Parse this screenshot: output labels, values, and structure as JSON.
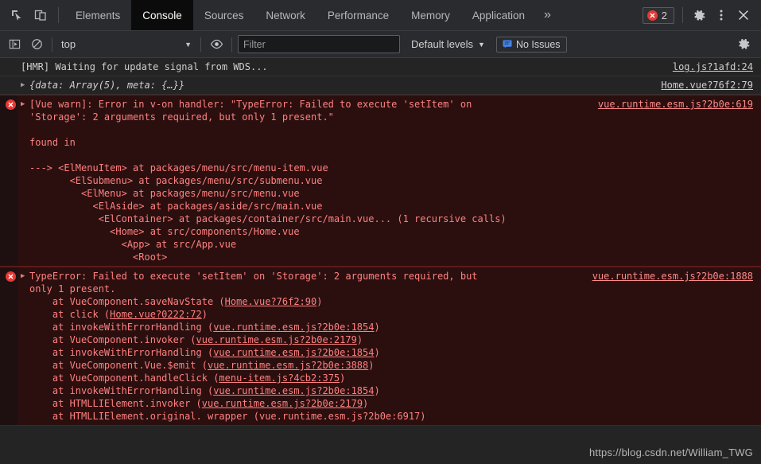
{
  "tabbar": {
    "icons": [
      {
        "name": "inspect-element-icon"
      },
      {
        "name": "device-toolbar-icon"
      }
    ],
    "tabs": [
      {
        "label": "Elements",
        "active": false
      },
      {
        "label": "Console",
        "active": true
      },
      {
        "label": "Sources",
        "active": false
      },
      {
        "label": "Network",
        "active": false
      },
      {
        "label": "Performance",
        "active": false
      },
      {
        "label": "Memory",
        "active": false
      },
      {
        "label": "Application",
        "active": false
      }
    ],
    "more_label": "»",
    "error_count": "2",
    "settings_icon": "gear-icon",
    "menu_icon": "kebab-menu-icon",
    "close_icon": "close-icon"
  },
  "filterbar": {
    "sidebar_toggle_icon": "console-sidebar-icon",
    "clear_icon": "clear-console-icon",
    "context": "top",
    "eye_icon": "live-expression-eye-icon",
    "filter_placeholder": "Filter",
    "filter_value": "",
    "levels_label": "Default levels",
    "issues_label": "No Issues",
    "issues_icon": "issues-message-icon",
    "settings_icon": "gear-icon"
  },
  "console": {
    "messages": [
      {
        "type": "log",
        "text": "[HMR] Waiting for update signal from WDS...",
        "source": "log.js?1afd:24",
        "expandable": false
      },
      {
        "type": "log",
        "text": "{data: Array(5), meta: {…}}",
        "source": "Home.vue?76f2:79",
        "expandable": true
      },
      {
        "type": "error",
        "text": "[Vue warn]: Error in v-on handler: \"TypeError: Failed to execute 'setItem' on\n'Storage': 2 arguments required, but only 1 present.\"\n\nfound in\n\n---> <ElMenuItem> at packages/menu/src/menu-item.vue\n       <ElSubmenu> at packages/menu/src/submenu.vue\n         <ElMenu> at packages/menu/src/menu.vue\n           <ElAside> at packages/aside/src/main.vue\n            <ElContainer> at packages/container/src/main.vue... (1 recursive calls)\n              <Home> at src/components/Home.vue\n                <App> at src/App.vue\n                  <Root>",
        "source": "vue.runtime.esm.js?2b0e:619",
        "expandable": true
      },
      {
        "type": "error",
        "text": "TypeError: Failed to execute 'setItem' on 'Storage': 2 arguments required, but\nonly 1 present.",
        "source": "vue.runtime.esm.js?2b0e:1888",
        "expandable": true,
        "stack": [
          {
            "fn": "    at VueComponent.saveNavState (",
            "link": "Home.vue?76f2:90",
            "tail": ")"
          },
          {
            "fn": "    at click (",
            "link": "Home.vue?0222:72",
            "tail": ")"
          },
          {
            "fn": "    at invokeWithErrorHandling (",
            "link": "vue.runtime.esm.js?2b0e:1854",
            "tail": ")"
          },
          {
            "fn": "    at VueComponent.invoker (",
            "link": "vue.runtime.esm.js?2b0e:2179",
            "tail": ")"
          },
          {
            "fn": "    at invokeWithErrorHandling (",
            "link": "vue.runtime.esm.js?2b0e:1854",
            "tail": ")"
          },
          {
            "fn": "    at VueComponent.Vue.$emit (",
            "link": "vue.runtime.esm.js?2b0e:3888",
            "tail": ")"
          },
          {
            "fn": "    at VueComponent.handleClick (",
            "link": "menu-item.js?4cb2:375",
            "tail": ")"
          },
          {
            "fn": "    at invokeWithErrorHandling (",
            "link": "vue.runtime.esm.js?2b0e:1854",
            "tail": ")"
          },
          {
            "fn": "    at HTMLLIElement.invoker (",
            "link": "vue.runtime.esm.js?2b0e:2179",
            "tail": ")"
          },
          {
            "fn": "    at HTMLLIElement.original. wrapper (vue.runtime.esm.js?2b0e:6917)",
            "link": "",
            "tail": ""
          }
        ]
      }
    ]
  },
  "watermark": "https://blog.csdn.net/William_TWG"
}
